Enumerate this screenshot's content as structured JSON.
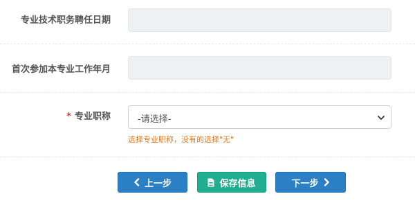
{
  "form": {
    "appointment_date_label": "专业技术职务聘任日期",
    "first_work_date_label": "首次参加本专业工作年月",
    "title_label": "专业职称",
    "required_marker": "*",
    "title_select_value": "-请选择-",
    "title_hint": "选择专业职称，没有的选择\"无\""
  },
  "buttons": {
    "prev_label": "上一步",
    "save_label": "保存信息",
    "next_label": "下一步"
  },
  "colors": {
    "primary_button": "#2a7fc5",
    "save_button": "#1fae8f",
    "hint_text": "#e07a1f",
    "required_star": "#e0322d"
  }
}
